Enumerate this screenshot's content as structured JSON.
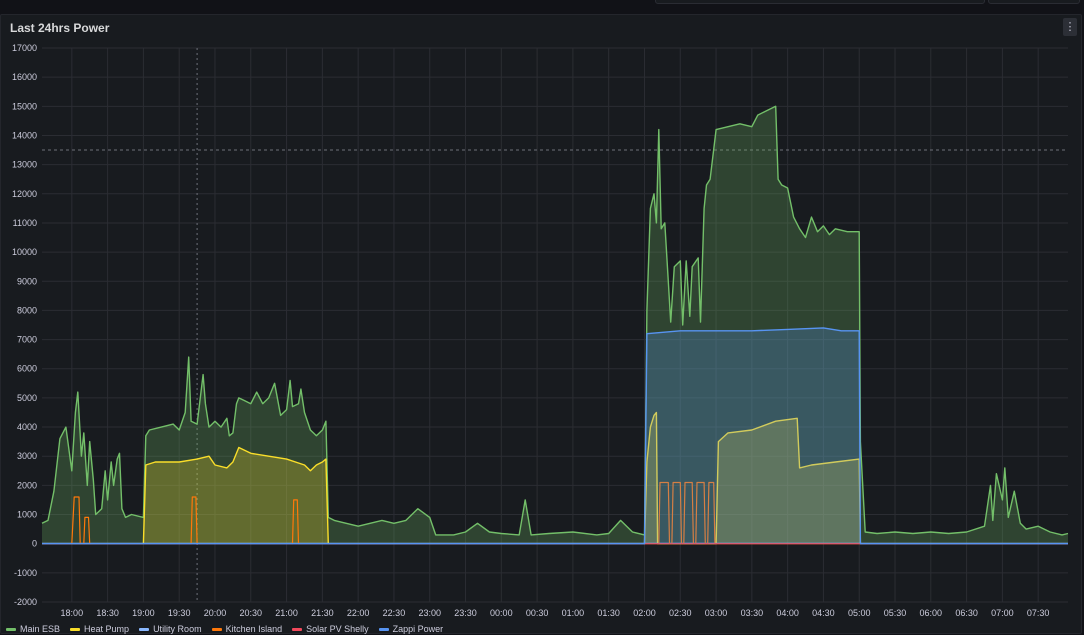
{
  "panel": {
    "title": "Last 24hrs Power",
    "menu_icon": "vertical-dots-icon"
  },
  "chart_data": {
    "type": "area",
    "ylim": [
      -2000,
      17000
    ],
    "yticks": [
      -2000,
      -1000,
      0,
      1000,
      2000,
      3000,
      4000,
      5000,
      6000,
      7000,
      8000,
      9000,
      10000,
      11000,
      12000,
      13000,
      14000,
      15000,
      16000,
      17000
    ],
    "xlim": [
      "17:35",
      "07:55"
    ],
    "xticks": [
      "18:00",
      "18:30",
      "19:00",
      "19:30",
      "20:00",
      "20:30",
      "21:00",
      "21:30",
      "22:00",
      "22:30",
      "23:00",
      "23:30",
      "00:00",
      "00:30",
      "01:00",
      "01:30",
      "02:00",
      "02:30",
      "03:00",
      "03:30",
      "04:00",
      "04:30",
      "05:00",
      "05:30",
      "06:00",
      "06:30",
      "07:00",
      "07:30"
    ],
    "grid": true,
    "legend_position": "bottom-left",
    "threshold_line": 13500,
    "cursor_time": "19:45",
    "series": [
      {
        "name": "Main ESB",
        "color": "#73bf69",
        "fill": true,
        "points": [
          [
            "17:35",
            700
          ],
          [
            "17:40",
            800
          ],
          [
            "17:45",
            1800
          ],
          [
            "17:50",
            3600
          ],
          [
            "17:55",
            4000
          ],
          [
            "18:00",
            2500
          ],
          [
            "18:03",
            4500
          ],
          [
            "18:05",
            5200
          ],
          [
            "18:08",
            3000
          ],
          [
            "18:10",
            3800
          ],
          [
            "18:13",
            2000
          ],
          [
            "18:15",
            3500
          ],
          [
            "18:18",
            2200
          ],
          [
            "18:20",
            1000
          ],
          [
            "18:25",
            1200
          ],
          [
            "18:28",
            2500
          ],
          [
            "18:30",
            1500
          ],
          [
            "18:33",
            2800
          ],
          [
            "18:35",
            2000
          ],
          [
            "18:38",
            2900
          ],
          [
            "18:40",
            3100
          ],
          [
            "18:42",
            1200
          ],
          [
            "18:45",
            900
          ],
          [
            "18:50",
            1000
          ],
          [
            "19:00",
            900
          ],
          [
            "19:02",
            3700
          ],
          [
            "19:05",
            3900
          ],
          [
            "19:15",
            4000
          ],
          [
            "19:25",
            4100
          ],
          [
            "19:30",
            3900
          ],
          [
            "19:35",
            4500
          ],
          [
            "19:38",
            6400
          ],
          [
            "19:40",
            4200
          ],
          [
            "19:45",
            4100
          ],
          [
            "19:50",
            5800
          ],
          [
            "19:52",
            4800
          ],
          [
            "19:55",
            4000
          ],
          [
            "20:00",
            4200
          ],
          [
            "20:05",
            4000
          ],
          [
            "20:10",
            4300
          ],
          [
            "20:12",
            3700
          ],
          [
            "20:15",
            3800
          ],
          [
            "20:18",
            4800
          ],
          [
            "20:20",
            5000
          ],
          [
            "20:25",
            4900
          ],
          [
            "20:30",
            4800
          ],
          [
            "20:35",
            5200
          ],
          [
            "20:40",
            4800
          ],
          [
            "20:45",
            5000
          ],
          [
            "20:50",
            5500
          ],
          [
            "20:55",
            4400
          ],
          [
            "21:00",
            4600
          ],
          [
            "21:03",
            5600
          ],
          [
            "21:05",
            4700
          ],
          [
            "21:10",
            4800
          ],
          [
            "21:12",
            5300
          ],
          [
            "21:15",
            4500
          ],
          [
            "21:20",
            3900
          ],
          [
            "21:25",
            3700
          ],
          [
            "21:30",
            3900
          ],
          [
            "21:33",
            4200
          ],
          [
            "21:35",
            900
          ],
          [
            "21:40",
            800
          ],
          [
            "21:50",
            700
          ],
          [
            "22:00",
            600
          ],
          [
            "22:10",
            700
          ],
          [
            "22:20",
            800
          ],
          [
            "22:30",
            700
          ],
          [
            "22:40",
            800
          ],
          [
            "22:50",
            1200
          ],
          [
            "23:00",
            900
          ],
          [
            "23:05",
            300
          ],
          [
            "23:20",
            300
          ],
          [
            "23:30",
            400
          ],
          [
            "23:40",
            700
          ],
          [
            "23:50",
            400
          ],
          [
            "00:00",
            350
          ],
          [
            "00:15",
            300
          ],
          [
            "00:20",
            1500
          ],
          [
            "00:25",
            300
          ],
          [
            "00:40",
            350
          ],
          [
            "01:00",
            400
          ],
          [
            "01:20",
            300
          ],
          [
            "01:30",
            350
          ],
          [
            "01:40",
            800
          ],
          [
            "01:50",
            400
          ],
          [
            "02:00",
            300
          ],
          [
            "02:02",
            8000
          ],
          [
            "02:05",
            11500
          ],
          [
            "02:08",
            12000
          ],
          [
            "02:10",
            11000
          ],
          [
            "02:12",
            14200
          ],
          [
            "02:14",
            10800
          ],
          [
            "02:17",
            11000
          ],
          [
            "02:20",
            9000
          ],
          [
            "02:22",
            7600
          ],
          [
            "02:25",
            9500
          ],
          [
            "02:30",
            9700
          ],
          [
            "02:32",
            7500
          ],
          [
            "02:35",
            9700
          ],
          [
            "02:38",
            7800
          ],
          [
            "02:40",
            9500
          ],
          [
            "02:45",
            9800
          ],
          [
            "02:47",
            7600
          ],
          [
            "02:50",
            11500
          ],
          [
            "02:52",
            12300
          ],
          [
            "02:55",
            12500
          ],
          [
            "03:00",
            14200
          ],
          [
            "03:10",
            14300
          ],
          [
            "03:20",
            14400
          ],
          [
            "03:30",
            14300
          ],
          [
            "03:35",
            14700
          ],
          [
            "03:40",
            14800
          ],
          [
            "03:50",
            15000
          ],
          [
            "03:52",
            12500
          ],
          [
            "03:55",
            12300
          ],
          [
            "04:00",
            12200
          ],
          [
            "04:05",
            11200
          ],
          [
            "04:10",
            10800
          ],
          [
            "04:15",
            10500
          ],
          [
            "04:20",
            11200
          ],
          [
            "04:25",
            10700
          ],
          [
            "04:30",
            10900
          ],
          [
            "04:35",
            10600
          ],
          [
            "04:40",
            10800
          ],
          [
            "04:50",
            10700
          ],
          [
            "05:00",
            10700
          ],
          [
            "05:01",
            3500
          ],
          [
            "05:05",
            400
          ],
          [
            "05:15",
            350
          ],
          [
            "05:30",
            400
          ],
          [
            "05:45",
            350
          ],
          [
            "06:00",
            400
          ],
          [
            "06:15",
            350
          ],
          [
            "06:30",
            400
          ],
          [
            "06:45",
            600
          ],
          [
            "06:50",
            2000
          ],
          [
            "06:52",
            800
          ],
          [
            "06:55",
            2400
          ],
          [
            "07:00",
            1500
          ],
          [
            "07:02",
            2600
          ],
          [
            "07:05",
            900
          ],
          [
            "07:10",
            1800
          ],
          [
            "07:15",
            700
          ],
          [
            "07:20",
            500
          ],
          [
            "07:30",
            600
          ],
          [
            "07:40",
            400
          ],
          [
            "07:50",
            300
          ],
          [
            "07:55",
            350
          ]
        ]
      },
      {
        "name": "Heat Pump",
        "color": "#fade2a",
        "fill": true,
        "points": [
          [
            "17:35",
            0
          ],
          [
            "19:00",
            0
          ],
          [
            "19:02",
            2700
          ],
          [
            "19:10",
            2800
          ],
          [
            "19:30",
            2800
          ],
          [
            "19:45",
            2900
          ],
          [
            "19:55",
            3000
          ],
          [
            "20:00",
            2700
          ],
          [
            "20:10",
            2600
          ],
          [
            "20:15",
            2800
          ],
          [
            "20:20",
            3300
          ],
          [
            "20:30",
            3100
          ],
          [
            "20:45",
            3000
          ],
          [
            "21:00",
            2900
          ],
          [
            "21:15",
            2700
          ],
          [
            "21:20",
            2500
          ],
          [
            "21:25",
            2700
          ],
          [
            "21:30",
            2800
          ],
          [
            "21:33",
            2900
          ],
          [
            "21:35",
            0
          ],
          [
            "02:00",
            0
          ],
          [
            "02:02",
            2800
          ],
          [
            "02:05",
            4000
          ],
          [
            "02:08",
            4400
          ],
          [
            "02:10",
            4500
          ],
          [
            "02:11",
            0
          ],
          [
            "03:00",
            0
          ],
          [
            "03:02",
            3500
          ],
          [
            "03:10",
            3800
          ],
          [
            "03:30",
            3900
          ],
          [
            "03:50",
            4200
          ],
          [
            "04:08",
            4300
          ],
          [
            "04:10",
            2600
          ],
          [
            "04:20",
            2700
          ],
          [
            "04:40",
            2800
          ],
          [
            "05:00",
            2900
          ],
          [
            "05:01",
            0
          ],
          [
            "07:55",
            0
          ]
        ]
      },
      {
        "name": "Utility Room",
        "color": "#8ab8ff",
        "fill": false,
        "points": [
          [
            "17:35",
            10
          ],
          [
            "07:55",
            10
          ]
        ]
      },
      {
        "name": "Kitchen Island",
        "color": "#ff780a",
        "fill": false,
        "points": [
          [
            "17:35",
            0
          ],
          [
            "18:00",
            0
          ],
          [
            "18:02",
            1600
          ],
          [
            "18:06",
            1600
          ],
          [
            "18:07",
            0
          ],
          [
            "18:10",
            0
          ],
          [
            "18:11",
            900
          ],
          [
            "18:14",
            900
          ],
          [
            "18:15",
            0
          ],
          [
            "19:40",
            0
          ],
          [
            "19:41",
            1600
          ],
          [
            "19:44",
            1600
          ],
          [
            "19:45",
            0
          ],
          [
            "21:05",
            0
          ],
          [
            "21:06",
            1500
          ],
          [
            "21:09",
            1500
          ],
          [
            "21:10",
            0
          ],
          [
            "02:12",
            0
          ],
          [
            "02:13",
            2100
          ],
          [
            "02:20",
            2100
          ],
          [
            "02:21",
            0
          ],
          [
            "02:23",
            0
          ],
          [
            "02:24",
            2100
          ],
          [
            "02:30",
            2100
          ],
          [
            "02:31",
            0
          ],
          [
            "02:33",
            0
          ],
          [
            "02:34",
            2100
          ],
          [
            "02:40",
            2100
          ],
          [
            "02:41",
            0
          ],
          [
            "02:43",
            0
          ],
          [
            "02:44",
            2100
          ],
          [
            "02:50",
            2100
          ],
          [
            "02:51",
            0
          ],
          [
            "02:53",
            0
          ],
          [
            "02:54",
            2100
          ],
          [
            "02:58",
            2100
          ],
          [
            "02:59",
            0
          ],
          [
            "07:55",
            0
          ]
        ]
      },
      {
        "name": "Solar PV Shelly",
        "color": "#f2495c",
        "fill": false,
        "points": [
          [
            "17:35",
            0
          ],
          [
            "07:55",
            0
          ]
        ]
      },
      {
        "name": "Zappi Power",
        "color": "#5794f2",
        "fill": true,
        "points": [
          [
            "17:35",
            0
          ],
          [
            "02:00",
            0
          ],
          [
            "02:02",
            7200
          ],
          [
            "02:30",
            7300
          ],
          [
            "03:00",
            7300
          ],
          [
            "03:30",
            7300
          ],
          [
            "04:00",
            7350
          ],
          [
            "04:30",
            7400
          ],
          [
            "04:45",
            7300
          ],
          [
            "05:00",
            7300
          ],
          [
            "05:01",
            0
          ],
          [
            "07:55",
            0
          ]
        ]
      }
    ]
  }
}
